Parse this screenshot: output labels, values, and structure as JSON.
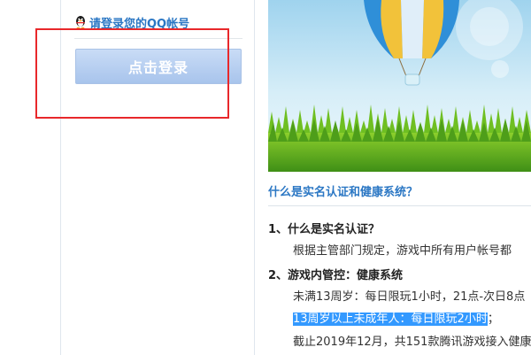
{
  "login_panel": {
    "prompt": "请登录您的QQ帐号",
    "login_button": "点击登录"
  },
  "article": {
    "title": "什么是实名认证和健康系统？",
    "section1": {
      "heading": "1、什么是实名认证？",
      "text": "根据主管部门规定，游戏中所有用户帐号都"
    },
    "section2": {
      "heading": "2、游戏内管控：健康系统",
      "line1": "未满13周岁：每日限玩1小时，21点-次日8点",
      "line2_highlight": "13周岁以上未成年人：每日限玩2小时",
      "line2_tail": "；",
      "line3": "截止2019年12月，共151款腾讯游戏接入健康"
    }
  },
  "colors": {
    "link_blue": "#2b77c4",
    "highlight": "#3399ff",
    "annotation_red": "#e8282b"
  }
}
